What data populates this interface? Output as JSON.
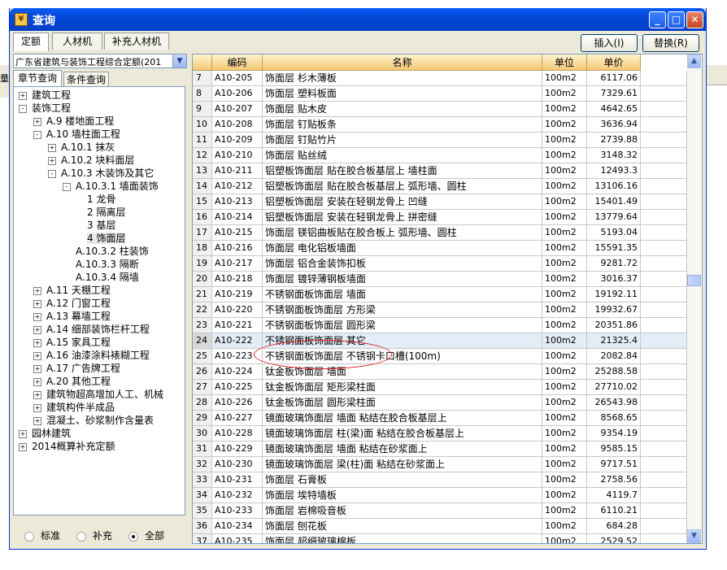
{
  "window": {
    "title": "查询",
    "controls": {
      "minimize": "_",
      "maximize": "□",
      "close": "✕"
    }
  },
  "background_fragment": "量",
  "tabs": [
    "定额",
    "人材机",
    "补充人材机"
  ],
  "buttons": {
    "insert": "插入(I)",
    "replace": "替换(R)"
  },
  "library_select": {
    "value": "广东省建筑与装饰工程综合定额(201"
  },
  "subtabs": [
    "章节查询",
    "条件查询"
  ],
  "tree": [
    {
      "label": "建筑工程",
      "toggle": "+"
    },
    {
      "label": "装饰工程",
      "toggle": "-"
    },
    {
      "label": "A.9 楼地面工程",
      "toggle": "+"
    },
    {
      "label": "A.10 墙柱面工程",
      "toggle": "-"
    },
    {
      "label": "A.10.1 抹灰",
      "toggle": "+"
    },
    {
      "label": "A.10.2 块料面层",
      "toggle": "+"
    },
    {
      "label": "A.10.3 木装饰及其它",
      "toggle": "-"
    },
    {
      "label": "A.10.3.1 墙面装饰",
      "toggle": "-"
    },
    {
      "label": "1 龙骨",
      "toggle": ""
    },
    {
      "label": "2 隔离层",
      "toggle": ""
    },
    {
      "label": "3 基层",
      "toggle": ""
    },
    {
      "label": "4 饰面层",
      "toggle": ""
    },
    {
      "label": "A.10.3.2 柱装饰",
      "toggle": ""
    },
    {
      "label": "A.10.3.3 隔断",
      "toggle": ""
    },
    {
      "label": "A.10.3.4 隔墙",
      "toggle": ""
    },
    {
      "label": "A.11 天棚工程",
      "toggle": "+"
    },
    {
      "label": "A.12 门窗工程",
      "toggle": "+"
    },
    {
      "label": "A.13 幕墙工程",
      "toggle": "+"
    },
    {
      "label": "A.14 细部装饰栏杆工程",
      "toggle": "+"
    },
    {
      "label": "A.15 家具工程",
      "toggle": "+"
    },
    {
      "label": "A.16 油漆涂料裱糊工程",
      "toggle": "+"
    },
    {
      "label": "A.17 广告牌工程",
      "toggle": "+"
    },
    {
      "label": "A.20 其他工程",
      "toggle": "+"
    },
    {
      "label": "建筑物超高增加人工、机械",
      "toggle": "+"
    },
    {
      "label": "建筑构件半成品",
      "toggle": "+"
    },
    {
      "label": "混凝土、砂浆制作含量表",
      "toggle": "+"
    },
    {
      "label": "园林建筑",
      "toggle": "+"
    },
    {
      "label": "2014概算补充定额",
      "toggle": "+"
    }
  ],
  "filters": {
    "options": [
      "标准",
      "补充",
      "全部"
    ],
    "selected": "全部"
  },
  "table": {
    "columns": [
      "编码",
      "名称",
      "单位",
      "单价"
    ],
    "rows": [
      [
        "7",
        "A10-205",
        "饰面层 杉木薄板",
        "100m2",
        "6117.06"
      ],
      [
        "8",
        "A10-206",
        "饰面层 塑料板面",
        "100m2",
        "7329.61"
      ],
      [
        "9",
        "A10-207",
        "饰面层 贴木皮",
        "100m2",
        "4642.65"
      ],
      [
        "10",
        "A10-208",
        "饰面层 钉贴板条",
        "100m2",
        "3636.94"
      ],
      [
        "11",
        "A10-209",
        "饰面层 钉贴竹片",
        "100m2",
        "2739.88"
      ],
      [
        "12",
        "A10-210",
        "饰面层 贴丝绒",
        "100m2",
        "3148.32"
      ],
      [
        "13",
        "A10-211",
        "铝塑板饰面层 贴在胶合板基层上 墙柱面",
        "100m2",
        "12493.3"
      ],
      [
        "14",
        "A10-212",
        "铝塑板饰面层 贴在胶合板基层上 弧形墙、圆柱",
        "100m2",
        "13106.16"
      ],
      [
        "15",
        "A10-213",
        "铝塑板饰面层 安装在轻钢龙骨上 凹缝",
        "100m2",
        "15401.49"
      ],
      [
        "16",
        "A10-214",
        "铝塑板饰面层 安装在轻钢龙骨上 拼密缝",
        "100m2",
        "13779.64"
      ],
      [
        "17",
        "A10-215",
        "饰面层 镁铝曲板贴在胶合板上 弧形墙、圆柱",
        "100m2",
        "5193.04"
      ],
      [
        "18",
        "A10-216",
        "饰面层 电化铝板墙面",
        "100m2",
        "15591.35"
      ],
      [
        "19",
        "A10-217",
        "饰面层 铝合金装饰扣板",
        "100m2",
        "9281.72"
      ],
      [
        "20",
        "A10-218",
        "饰面层 镀锌薄钢板墙面",
        "100m2",
        "3016.37"
      ],
      [
        "21",
        "A10-219",
        "不锈钢面板饰面层 墙面",
        "100m2",
        "19192.11"
      ],
      [
        "22",
        "A10-220",
        "不锈钢面板饰面层 方形梁",
        "100m2",
        "19932.67"
      ],
      [
        "23",
        "A10-221",
        "不锈钢面板饰面层 圆形梁",
        "100m2",
        "20351.86"
      ],
      [
        "24",
        "A10-222",
        "不锈钢面板饰面层 其它",
        "100m2",
        "21325.4"
      ],
      [
        "25",
        "A10-223",
        "不锈钢面板饰面层 不锈钢卡口槽(100m)",
        "100m2",
        "2082.84"
      ],
      [
        "26",
        "A10-224",
        "钛金板饰面层 墙面",
        "100m2",
        "25288.58"
      ],
      [
        "27",
        "A10-225",
        "钛金板饰面层 矩形梁柱面",
        "100m2",
        "27710.02"
      ],
      [
        "28",
        "A10-226",
        "钛金板饰面层 圆形梁柱面",
        "100m2",
        "26543.98"
      ],
      [
        "29",
        "A10-227",
        "镜面玻璃饰面层 墙面 粘结在胶合板基层上",
        "100m2",
        "8568.65"
      ],
      [
        "30",
        "A10-228",
        "镜面玻璃饰面层 柱(梁)面 粘结在胶合板基层上",
        "100m2",
        "9354.19"
      ],
      [
        "31",
        "A10-229",
        "镜面玻璃饰面层 墙面 粘结在砂浆面上",
        "100m2",
        "9585.15"
      ],
      [
        "32",
        "A10-230",
        "镜面玻璃饰面层 梁(柱)面 粘结在砂浆面上",
        "100m2",
        "9717.51"
      ],
      [
        "33",
        "A10-231",
        "饰面层 石膏板",
        "100m2",
        "2758.56"
      ],
      [
        "34",
        "A10-232",
        "饰面层 埃特墙板",
        "100m2",
        "4119.7"
      ],
      [
        "35",
        "A10-233",
        "饰面层 岩棉吸音板",
        "100m2",
        "6110.21"
      ],
      [
        "36",
        "A10-234",
        "饰面层 刨花板",
        "100m2",
        "684.28"
      ],
      [
        "37",
        "A10-235",
        "饰面层 超细玻璃棉板",
        "100m2",
        "2529.52"
      ]
    ],
    "highlighted_row": "24"
  },
  "scroll": {
    "up": "▲",
    "down": "▼"
  }
}
